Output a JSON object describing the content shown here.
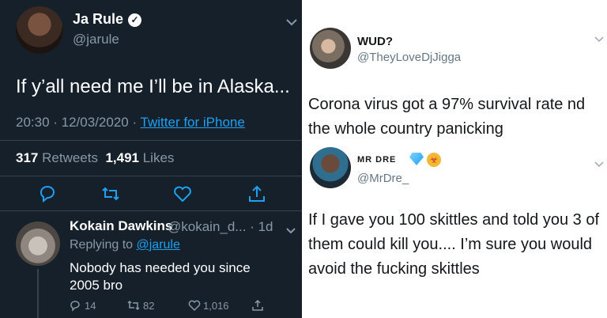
{
  "left_tweet": {
    "author_name": "Ja Rule",
    "author_handle": "@jarule",
    "verified_glyph": "✓",
    "text": "If y’all need me I’ll be in Alaska...",
    "timestamp": "20:30 · 12/03/2020 · ",
    "source": "Twitter for iPhone",
    "retweets_count": "317",
    "retweets_label": "Retweets",
    "likes_count": "1,491",
    "likes_label": "Likes",
    "icons": [
      "reply-icon",
      "retweet-icon",
      "like-icon",
      "share-icon",
      "chevron-down-icon"
    ]
  },
  "reply": {
    "author_name": "Kokain Dawkins",
    "author_handle": "@kokain_d... · 1d",
    "replying_prefix": "Replying to ",
    "replying_to": "@jarule",
    "text": "Nobody has needed you since 2005 bro",
    "reply_count": "14",
    "retweet_count": "82",
    "like_count": "1,016"
  },
  "right_tweets": [
    {
      "author_name": "WUD?",
      "author_handle": "@TheyLoveDjJigga",
      "text": "Corona virus got a 97% survival rate nd the whole country panicking"
    },
    {
      "author_name": "MR DRE",
      "author_handle": "@MrDre_",
      "text": "If I gave you 100 skittles and told you 3 of them could kill you.... I’m sure you would avoid the fucking skittles"
    }
  ],
  "colors": {
    "dark_bg": "#15202b",
    "muted": "#8899a6",
    "accent": "#1da1f2",
    "light_bg": "#ffffff",
    "dark_text": "#14171a"
  }
}
